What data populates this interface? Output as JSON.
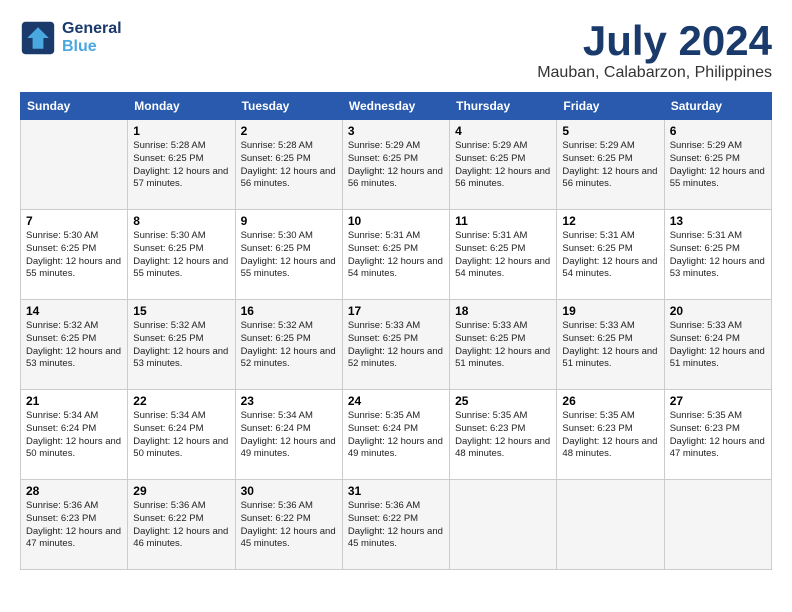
{
  "header": {
    "logo_line1": "General",
    "logo_line2": "Blue",
    "month": "July 2024",
    "location": "Mauban, Calabarzon, Philippines"
  },
  "weekdays": [
    "Sunday",
    "Monday",
    "Tuesday",
    "Wednesday",
    "Thursday",
    "Friday",
    "Saturday"
  ],
  "weeks": [
    [
      {
        "day": "",
        "detail": ""
      },
      {
        "day": "1",
        "detail": "Sunrise: 5:28 AM\nSunset: 6:25 PM\nDaylight: 12 hours\nand 57 minutes."
      },
      {
        "day": "2",
        "detail": "Sunrise: 5:28 AM\nSunset: 6:25 PM\nDaylight: 12 hours\nand 56 minutes."
      },
      {
        "day": "3",
        "detail": "Sunrise: 5:29 AM\nSunset: 6:25 PM\nDaylight: 12 hours\nand 56 minutes."
      },
      {
        "day": "4",
        "detail": "Sunrise: 5:29 AM\nSunset: 6:25 PM\nDaylight: 12 hours\nand 56 minutes."
      },
      {
        "day": "5",
        "detail": "Sunrise: 5:29 AM\nSunset: 6:25 PM\nDaylight: 12 hours\nand 56 minutes."
      },
      {
        "day": "6",
        "detail": "Sunrise: 5:29 AM\nSunset: 6:25 PM\nDaylight: 12 hours\nand 55 minutes."
      }
    ],
    [
      {
        "day": "7",
        "detail": "Sunrise: 5:30 AM\nSunset: 6:25 PM\nDaylight: 12 hours\nand 55 minutes."
      },
      {
        "day": "8",
        "detail": "Sunrise: 5:30 AM\nSunset: 6:25 PM\nDaylight: 12 hours\nand 55 minutes."
      },
      {
        "day": "9",
        "detail": "Sunrise: 5:30 AM\nSunset: 6:25 PM\nDaylight: 12 hours\nand 55 minutes."
      },
      {
        "day": "10",
        "detail": "Sunrise: 5:31 AM\nSunset: 6:25 PM\nDaylight: 12 hours\nand 54 minutes."
      },
      {
        "day": "11",
        "detail": "Sunrise: 5:31 AM\nSunset: 6:25 PM\nDaylight: 12 hours\nand 54 minutes."
      },
      {
        "day": "12",
        "detail": "Sunrise: 5:31 AM\nSunset: 6:25 PM\nDaylight: 12 hours\nand 54 minutes."
      },
      {
        "day": "13",
        "detail": "Sunrise: 5:31 AM\nSunset: 6:25 PM\nDaylight: 12 hours\nand 53 minutes."
      }
    ],
    [
      {
        "day": "14",
        "detail": "Sunrise: 5:32 AM\nSunset: 6:25 PM\nDaylight: 12 hours\nand 53 minutes."
      },
      {
        "day": "15",
        "detail": "Sunrise: 5:32 AM\nSunset: 6:25 PM\nDaylight: 12 hours\nand 53 minutes."
      },
      {
        "day": "16",
        "detail": "Sunrise: 5:32 AM\nSunset: 6:25 PM\nDaylight: 12 hours\nand 52 minutes."
      },
      {
        "day": "17",
        "detail": "Sunrise: 5:33 AM\nSunset: 6:25 PM\nDaylight: 12 hours\nand 52 minutes."
      },
      {
        "day": "18",
        "detail": "Sunrise: 5:33 AM\nSunset: 6:25 PM\nDaylight: 12 hours\nand 51 minutes."
      },
      {
        "day": "19",
        "detail": "Sunrise: 5:33 AM\nSunset: 6:25 PM\nDaylight: 12 hours\nand 51 minutes."
      },
      {
        "day": "20",
        "detail": "Sunrise: 5:33 AM\nSunset: 6:24 PM\nDaylight: 12 hours\nand 51 minutes."
      }
    ],
    [
      {
        "day": "21",
        "detail": "Sunrise: 5:34 AM\nSunset: 6:24 PM\nDaylight: 12 hours\nand 50 minutes."
      },
      {
        "day": "22",
        "detail": "Sunrise: 5:34 AM\nSunset: 6:24 PM\nDaylight: 12 hours\nand 50 minutes."
      },
      {
        "day": "23",
        "detail": "Sunrise: 5:34 AM\nSunset: 6:24 PM\nDaylight: 12 hours\nand 49 minutes."
      },
      {
        "day": "24",
        "detail": "Sunrise: 5:35 AM\nSunset: 6:24 PM\nDaylight: 12 hours\nand 49 minutes."
      },
      {
        "day": "25",
        "detail": "Sunrise: 5:35 AM\nSunset: 6:23 PM\nDaylight: 12 hours\nand 48 minutes."
      },
      {
        "day": "26",
        "detail": "Sunrise: 5:35 AM\nSunset: 6:23 PM\nDaylight: 12 hours\nand 48 minutes."
      },
      {
        "day": "27",
        "detail": "Sunrise: 5:35 AM\nSunset: 6:23 PM\nDaylight: 12 hours\nand 47 minutes."
      }
    ],
    [
      {
        "day": "28",
        "detail": "Sunrise: 5:36 AM\nSunset: 6:23 PM\nDaylight: 12 hours\nand 47 minutes."
      },
      {
        "day": "29",
        "detail": "Sunrise: 5:36 AM\nSunset: 6:22 PM\nDaylight: 12 hours\nand 46 minutes."
      },
      {
        "day": "30",
        "detail": "Sunrise: 5:36 AM\nSunset: 6:22 PM\nDaylight: 12 hours\nand 45 minutes."
      },
      {
        "day": "31",
        "detail": "Sunrise: 5:36 AM\nSunset: 6:22 PM\nDaylight: 12 hours\nand 45 minutes."
      },
      {
        "day": "",
        "detail": ""
      },
      {
        "day": "",
        "detail": ""
      },
      {
        "day": "",
        "detail": ""
      }
    ]
  ]
}
